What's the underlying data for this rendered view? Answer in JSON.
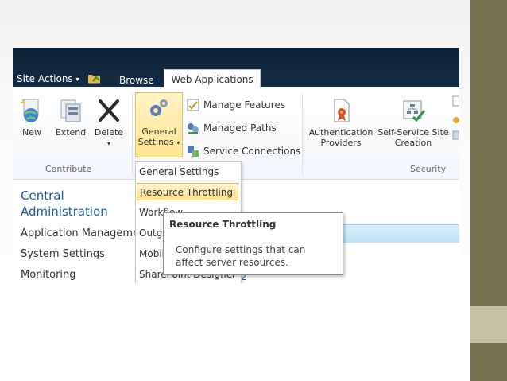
{
  "topbar": {
    "site_actions_label": "Site Actions",
    "site_actions_caret": "▾",
    "browse_tab": "Browse",
    "active_tab": "Web Applications"
  },
  "ribbon": {
    "contribute": {
      "group_label": "Contribute",
      "new_label": "New",
      "extend_label": "Extend",
      "delete_label": "Delete",
      "delete_caret": "▾"
    },
    "manage": {
      "general_settings_line1": "General",
      "general_settings_line2": "Settings",
      "general_settings_caret": "▾",
      "manage_features": "Manage Features",
      "managed_paths": "Managed Paths",
      "service_connections": "Service Connections"
    },
    "security": {
      "group_label": "Security",
      "auth_line1": "Authentication",
      "auth_line2": "Providers",
      "self_service_line1": "Self-Service Site",
      "self_service_line2": "Creation"
    }
  },
  "left_nav": {
    "title_line1": "Central",
    "title_line2": "Administration",
    "items": [
      "Application Managemer",
      "System Settings",
      "Monitoring"
    ]
  },
  "dropdown": {
    "items": [
      "General Settings",
      "Resource Throttling",
      "Workflow",
      "Outgo",
      "Mobil",
      "SharePoint Designer"
    ],
    "highlighted_index": 1
  },
  "tooltip": {
    "title": "Resource Throttling",
    "body": "Configure settings that can affect server resources."
  },
  "page_fragment": "2",
  "colors": {
    "topbar": "#0c2236",
    "accent_band": "#757250",
    "accent_band_light": "#c3c2a4",
    "highlight": "#fde38e",
    "link_blue": "#1b5aa7"
  }
}
